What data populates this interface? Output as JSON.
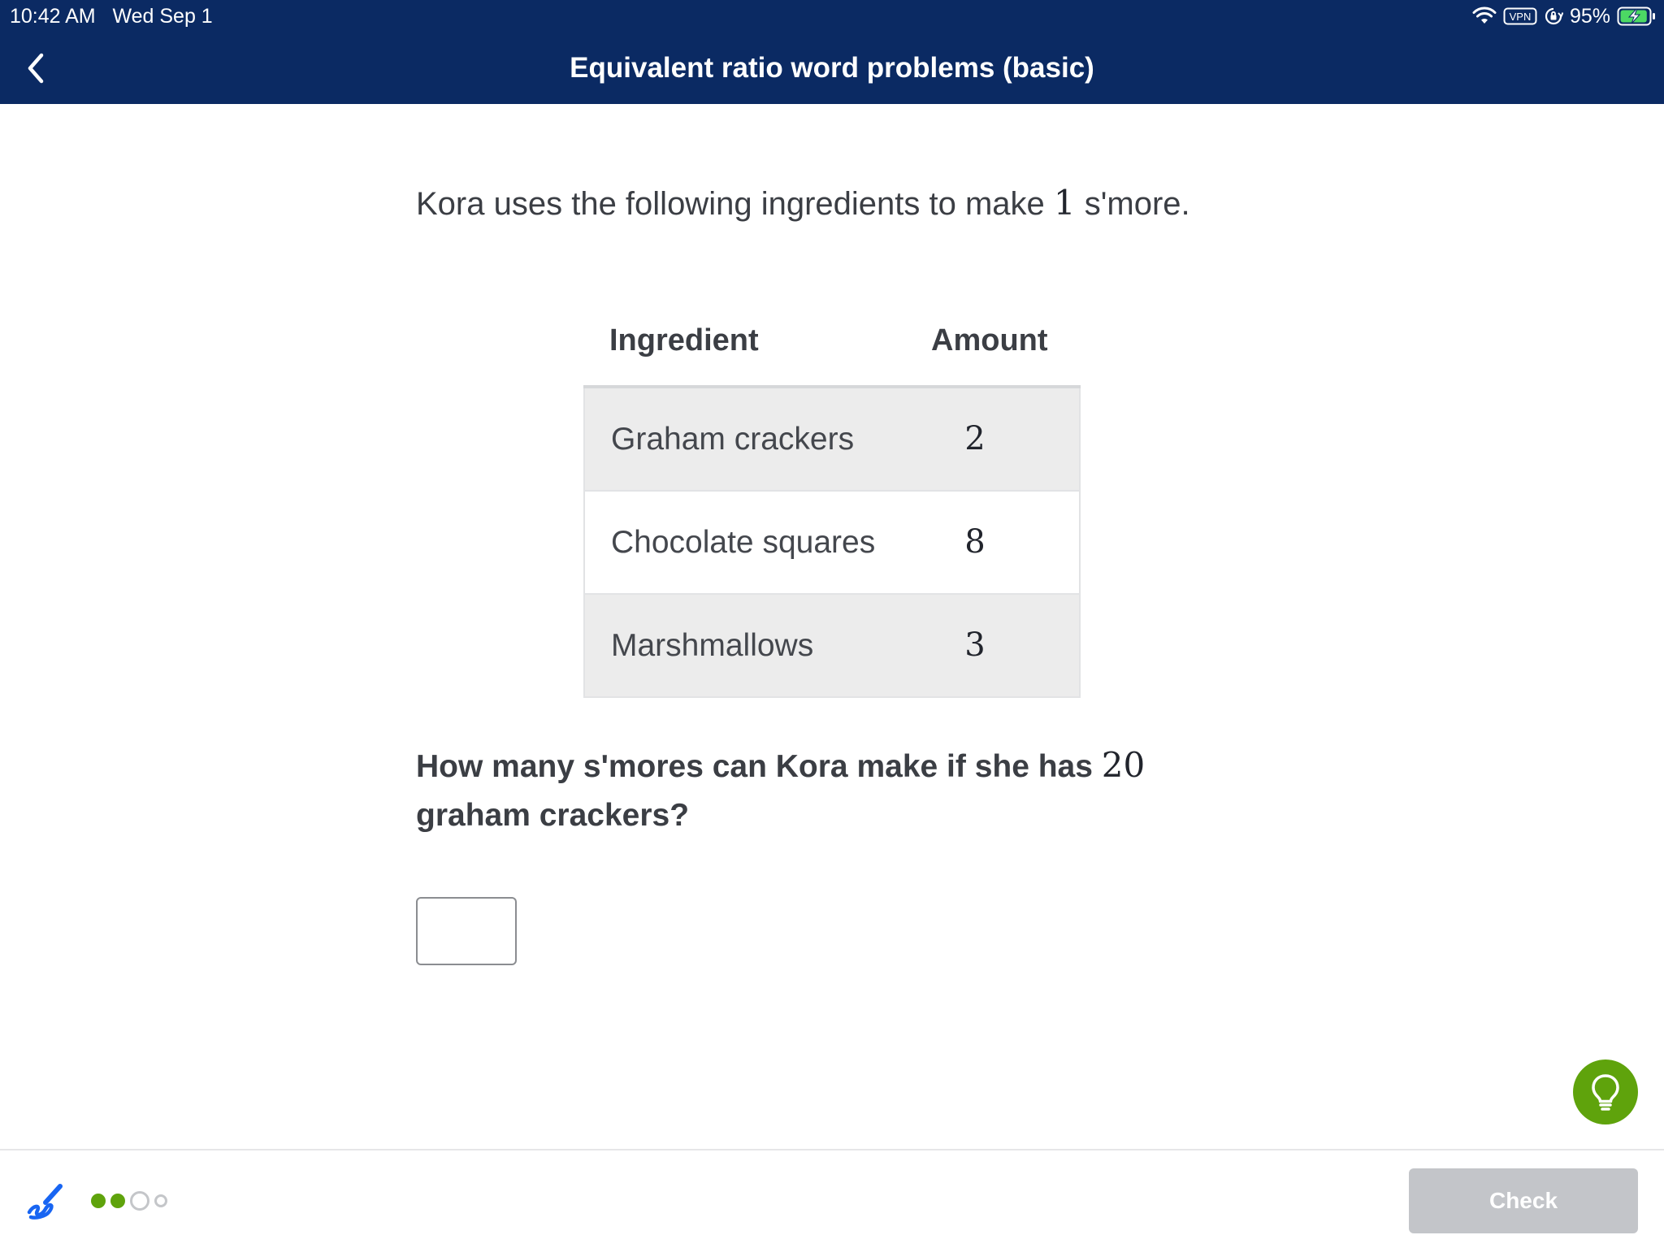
{
  "status_bar": {
    "time": "10:42 AM",
    "date": "Wed Sep 1",
    "vpn_label": "VPN",
    "battery": "95%",
    "battery_level": 0.95,
    "icons": [
      "wifi-icon",
      "vpn-icon",
      "orientation-lock-icon",
      "battery-charging-icon"
    ]
  },
  "header": {
    "title": "Equivalent ratio word problems (basic)",
    "back_icon": "chevron-left-icon",
    "background_color": "#0b2a63"
  },
  "problem": {
    "prompt_before": "Kora uses the following ingredients to make",
    "prompt_number": "1",
    "prompt_after": "s'more.",
    "table": {
      "headers": [
        "Ingredient",
        "Amount"
      ],
      "rows": [
        {
          "ingredient": "Graham crackers",
          "amount": "2"
        },
        {
          "ingredient": "Chocolate squares",
          "amount": "8"
        },
        {
          "ingredient": "Marshmallows",
          "amount": "3"
        }
      ]
    },
    "question_before": "How many s'mores can Kora make if she has",
    "question_number": "20",
    "question_after": "graham crackers?",
    "answer_value": ""
  },
  "hint": {
    "icon": "lightbulb-icon",
    "color": "#5fa30c"
  },
  "footer": {
    "scratchpad_icon": "scratchpad-pencil-icon",
    "progress": {
      "completed": 2,
      "current": 3,
      "total": 4
    },
    "check_label": "Check"
  }
}
